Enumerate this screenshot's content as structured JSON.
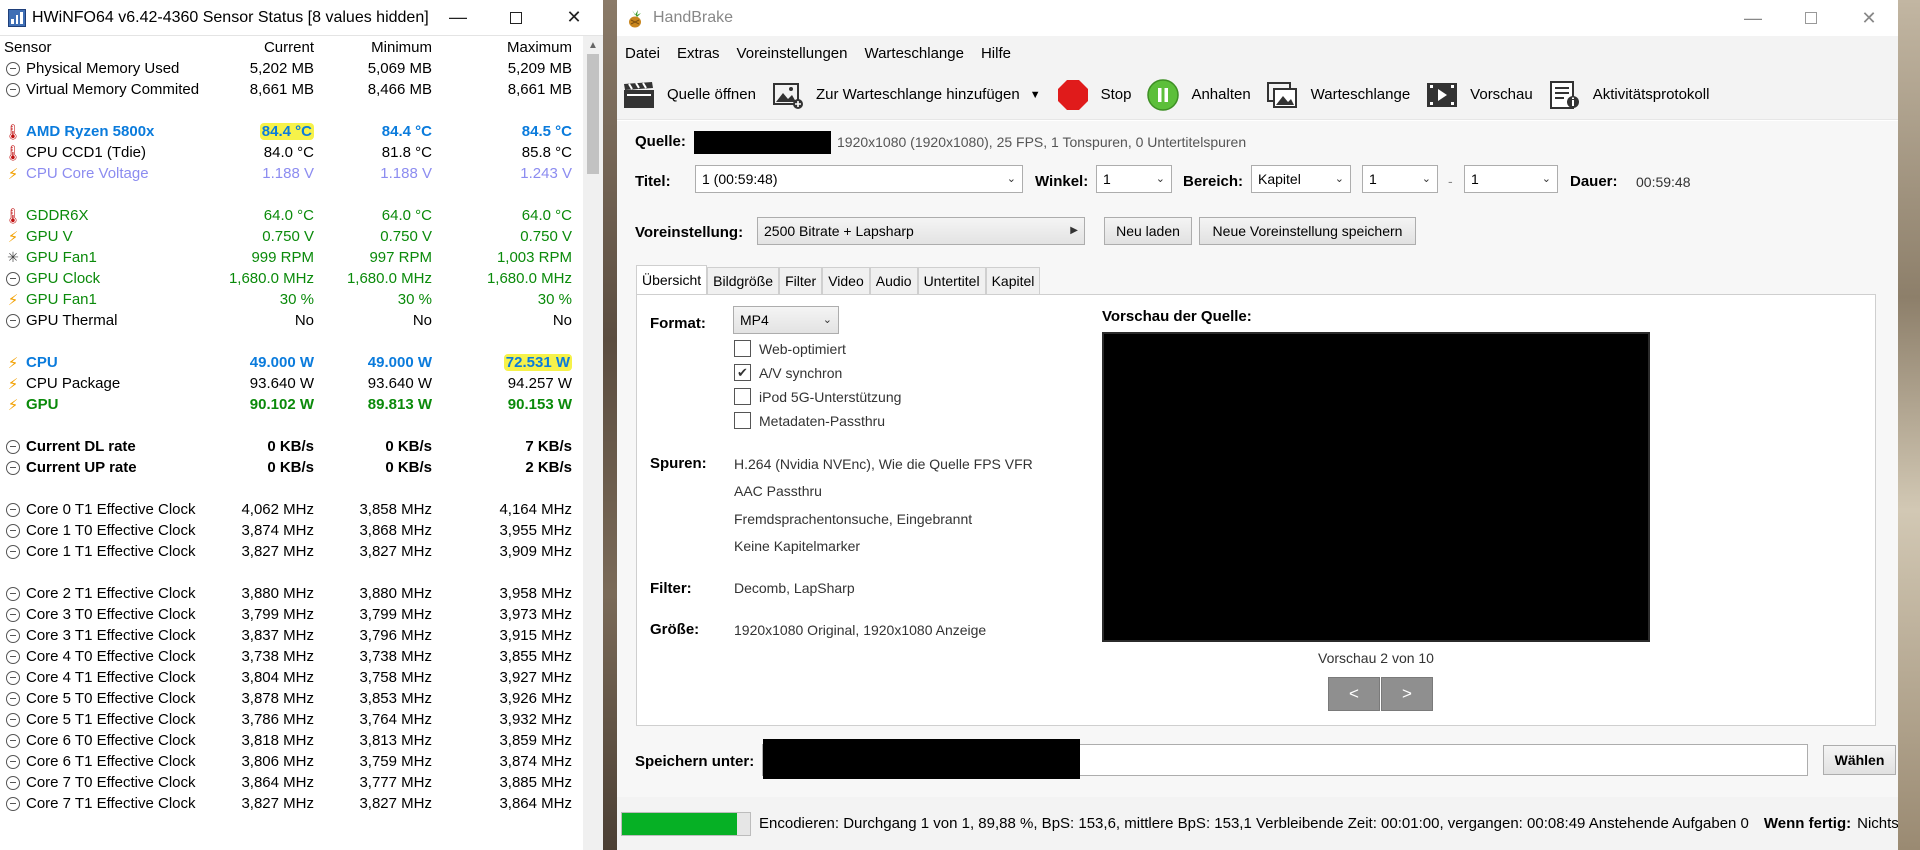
{
  "hwinfo": {
    "title": "HWiNFO64 v6.42-4360 Sensor Status [8 values hidden]",
    "columns": [
      "Sensor",
      "Current",
      "Minimum",
      "Maximum"
    ],
    "rows": [
      {
        "icon": "clock",
        "name": "Physical Memory Used",
        "cur": "5,202 MB",
        "min": "5,069 MB",
        "max": "5,209 MB",
        "style": ""
      },
      {
        "icon": "clock",
        "name": "Virtual Memory Commited",
        "cur": "8,661 MB",
        "min": "8,466 MB",
        "max": "8,661 MB",
        "style": ""
      },
      {
        "blank": true
      },
      {
        "icon": "temp",
        "name": "AMD Ryzen 5800x",
        "cur": "84.4 °C",
        "min": "84.4 °C",
        "max": "84.5 °C",
        "style": "blue",
        "hl": "cur"
      },
      {
        "icon": "temp",
        "name": "CPU CCD1 (Tdie)",
        "cur": "84.0 °C",
        "min": "81.8 °C",
        "max": "85.8 °C",
        "style": ""
      },
      {
        "icon": "volt",
        "name": "CPU Core Voltage",
        "cur": "1.188 V",
        "min": "1.188 V",
        "max": "1.243 V",
        "style": "lblue"
      },
      {
        "blank": true
      },
      {
        "icon": "temp",
        "name": "GDDR6X",
        "cur": "64.0 °C",
        "min": "64.0 °C",
        "max": "64.0 °C",
        "style": "green"
      },
      {
        "icon": "volt",
        "name": "GPU V",
        "cur": "0.750 V",
        "min": "0.750 V",
        "max": "0.750 V",
        "style": "green"
      },
      {
        "icon": "fan",
        "name": "GPU Fan1",
        "cur": "999 RPM",
        "min": "997 RPM",
        "max": "1,003 RPM",
        "style": "green"
      },
      {
        "icon": "clock",
        "name": "GPU Clock",
        "cur": "1,680.0 MHz",
        "min": "1,680.0 MHz",
        "max": "1,680.0 MHz",
        "style": "green"
      },
      {
        "icon": "volt",
        "name": "GPU Fan1",
        "cur": "30 %",
        "min": "30 %",
        "max": "30 %",
        "style": "green"
      },
      {
        "icon": "clock",
        "name": "GPU Thermal",
        "cur": "No",
        "min": "No",
        "max": "No",
        "style": ""
      },
      {
        "blank": true
      },
      {
        "icon": "volt",
        "name": "CPU",
        "cur": "49.000 W",
        "min": "49.000 W",
        "max": "72.531 W",
        "style": "blue",
        "hl": "max"
      },
      {
        "icon": "volt",
        "name": "CPU Package",
        "cur": "93.640 W",
        "min": "93.640 W",
        "max": "94.257 W",
        "style": ""
      },
      {
        "icon": "volt",
        "name": "GPU",
        "cur": "90.102 W",
        "min": "89.813 W",
        "max": "90.153 W",
        "style": "dgreen"
      },
      {
        "blank": true
      },
      {
        "icon": "clock",
        "name": "Current DL rate",
        "cur": "0 KB/s",
        "min": "0 KB/s",
        "max": "7 KB/s",
        "style": "bold"
      },
      {
        "icon": "clock",
        "name": "Current UP rate",
        "cur": "0 KB/s",
        "min": "0 KB/s",
        "max": "2 KB/s",
        "style": "bold"
      },
      {
        "blank": true
      },
      {
        "icon": "clock",
        "name": "Core 0 T1 Effective Clock",
        "cur": "4,062 MHz",
        "min": "3,858 MHz",
        "max": "4,164 MHz",
        "style": ""
      },
      {
        "icon": "clock",
        "name": "Core 1 T0 Effective Clock",
        "cur": "3,874 MHz",
        "min": "3,868 MHz",
        "max": "3,955 MHz",
        "style": ""
      },
      {
        "icon": "clock",
        "name": "Core 1 T1 Effective Clock",
        "cur": "3,827 MHz",
        "min": "3,827 MHz",
        "max": "3,909 MHz",
        "style": ""
      },
      {
        "blank": true
      },
      {
        "icon": "clock",
        "name": "Core 2 T1 Effective Clock",
        "cur": "3,880 MHz",
        "min": "3,880 MHz",
        "max": "3,958 MHz",
        "style": ""
      },
      {
        "icon": "clock",
        "name": "Core 3 T0 Effective Clock",
        "cur": "3,799 MHz",
        "min": "3,799 MHz",
        "max": "3,973 MHz",
        "style": ""
      },
      {
        "icon": "clock",
        "name": "Core 3 T1 Effective Clock",
        "cur": "3,837 MHz",
        "min": "3,796 MHz",
        "max": "3,915 MHz",
        "style": ""
      },
      {
        "icon": "clock",
        "name": "Core 4 T0 Effective Clock",
        "cur": "3,738 MHz",
        "min": "3,738 MHz",
        "max": "3,855 MHz",
        "style": ""
      },
      {
        "icon": "clock",
        "name": "Core 4 T1 Effective Clock",
        "cur": "3,804 MHz",
        "min": "3,758 MHz",
        "max": "3,927 MHz",
        "style": ""
      },
      {
        "icon": "clock",
        "name": "Core 5 T0 Effective Clock",
        "cur": "3,878 MHz",
        "min": "3,853 MHz",
        "max": "3,926 MHz",
        "style": ""
      },
      {
        "icon": "clock",
        "name": "Core 5 T1 Effective Clock",
        "cur": "3,786 MHz",
        "min": "3,764 MHz",
        "max": "3,932 MHz",
        "style": ""
      },
      {
        "icon": "clock",
        "name": "Core 6 T0 Effective Clock",
        "cur": "3,818 MHz",
        "min": "3,813 MHz",
        "max": "3,859 MHz",
        "style": ""
      },
      {
        "icon": "clock",
        "name": "Core 6 T1 Effective Clock",
        "cur": "3,806 MHz",
        "min": "3,759 MHz",
        "max": "3,874 MHz",
        "style": ""
      },
      {
        "icon": "clock",
        "name": "Core 7 T0 Effective Clock",
        "cur": "3,864 MHz",
        "min": "3,777 MHz",
        "max": "3,885 MHz",
        "style": ""
      },
      {
        "icon": "clock",
        "name": "Core 7 T1 Effective Clock",
        "cur": "3,827 MHz",
        "min": "3,827 MHz",
        "max": "3,864 MHz",
        "style": ""
      }
    ]
  },
  "handbrake": {
    "title": "HandBrake",
    "menu": [
      "Datei",
      "Extras",
      "Voreinstellungen",
      "Warteschlange",
      "Hilfe"
    ],
    "toolbar": {
      "open_source": "Quelle öffnen",
      "add_queue": "Zur Warteschlange hinzufügen",
      "stop": "Stop",
      "pause": "Anhalten",
      "queue": "Warteschlange",
      "preview": "Vorschau",
      "activity_log": "Aktivitätsprotokoll"
    },
    "source": {
      "label": "Quelle:",
      "info": "1920x1080 (1920x1080), 25 FPS, 1 Tonspuren, 0 Untertitelspuren"
    },
    "title_row": {
      "label": "Titel:",
      "value": "1  (00:59:48)",
      "angle_label": "Winkel:",
      "angle_value": "1",
      "range_label": "Bereich:",
      "range_type": "Kapitel",
      "range_start": "1",
      "range_sep": "-",
      "range_end": "1",
      "duration_label": "Dauer:",
      "duration_value": "00:59:48"
    },
    "preset": {
      "label": "Voreinstellung:",
      "value": "2500 Bitrate + Lapsharp",
      "reload": "Neu laden",
      "save_new": "Neue Voreinstellung speichern"
    },
    "tabs": [
      "Übersicht",
      "Bildgröße",
      "Filter",
      "Video",
      "Audio",
      "Untertitel",
      "Kapitel"
    ],
    "summary": {
      "format_label": "Format:",
      "format_value": "MP4",
      "checks": [
        {
          "label": "Web-optimiert",
          "checked": false
        },
        {
          "label": "A/V synchron",
          "checked": true
        },
        {
          "label": "iPod 5G-Unterstützung",
          "checked": false
        },
        {
          "label": "Metadaten-Passthru",
          "checked": false
        }
      ],
      "tracks_label": "Spuren:",
      "tracks": [
        "H.264 (Nvidia NVEnc), Wie die Quelle FPS VFR",
        "AAC Passthru",
        "Fremdsprachentonsuche, Eingebrannt",
        "Keine Kapitelmarker"
      ],
      "filter_label": "Filter:",
      "filter_value": "Decomb, LapSharp",
      "size_label": "Größe:",
      "size_value": "1920x1080 Original, 1920x1080 Anzeige",
      "preview_title": "Vorschau der Quelle:",
      "preview_counter": "Vorschau 2 von 10",
      "prev": "<",
      "next": ">"
    },
    "save": {
      "label": "Speichern unter:",
      "browse": "Wählen"
    },
    "status": {
      "progress": 89.88,
      "text": "Encodieren: Durchgang 1 von 1, 89,88 %, BpS: 153,6, mittlere BpS: 153,1 Verbleibende Zeit: 00:01:00, vergangen: 00:08:49 Anstehende Aufgaben 0",
      "when_done_label": "Wenn fertig:",
      "when_done_value": "Nichts"
    }
  }
}
